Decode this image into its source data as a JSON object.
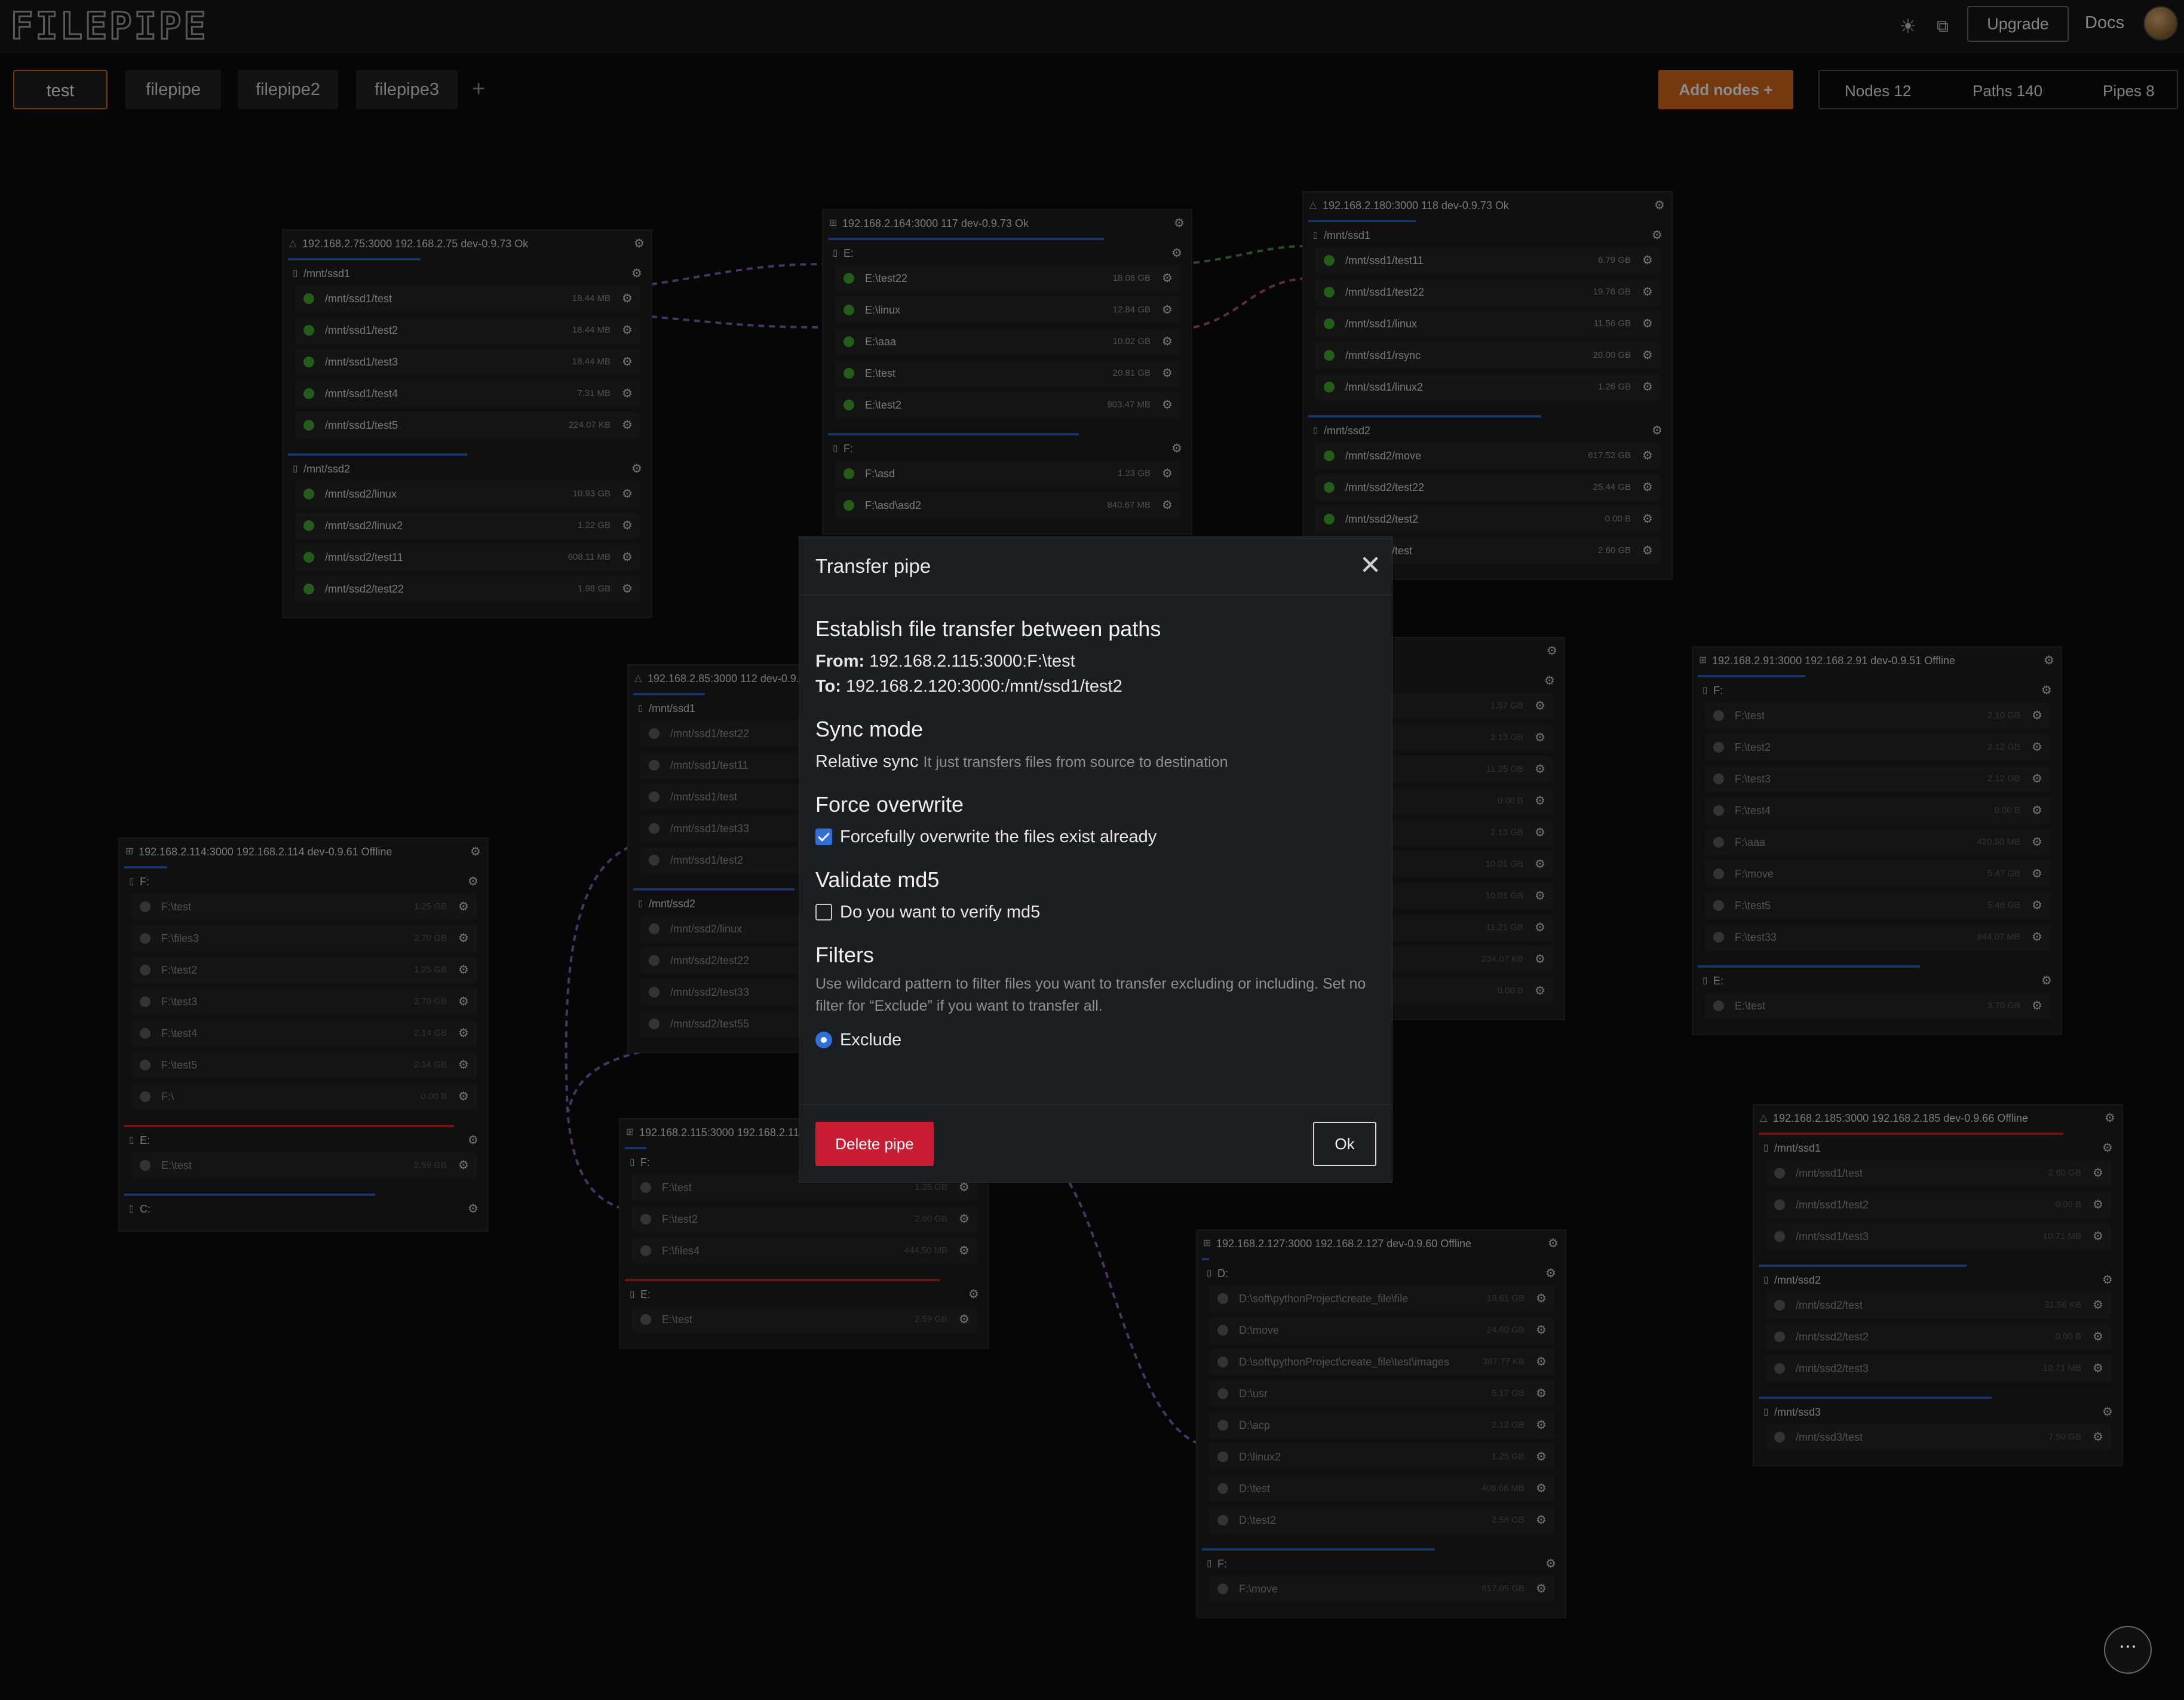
{
  "app": {
    "logo": "FILEPIPE"
  },
  "header": {
    "upgrade_label": "Upgrade",
    "docs_label": "Docs"
  },
  "tabs": [
    {
      "label": "test",
      "active": true
    },
    {
      "label": "filepipe"
    },
    {
      "label": "filepipe2"
    },
    {
      "label": "filepipe3"
    }
  ],
  "toolbar": {
    "add_nodes_label": "Add nodes",
    "nodes_stat": "Nodes 12",
    "paths_stat": "Paths 140",
    "pipes_stat": "Pipes 8"
  },
  "colors": {
    "accent": "#c9631b",
    "link_purple": "#7e5bb0",
    "link_green": "#3f8f3a",
    "link_pink": "#a0506a",
    "ok_dot": "#3e9f2c",
    "primary_blue": "#2f6fdc",
    "danger": "#c81d33"
  },
  "nodes": [
    {
      "id": "n75",
      "os": "linux",
      "status": "ok",
      "header": "192.168.2.75:3000  192.168.2.75  dev-0.9.73  Ok",
      "drives": [
        {
          "name": "/mnt/ssd1",
          "usage": 0.37,
          "bar_color": "blue",
          "paths": [
            {
              "name": "/mnt/ssd1/test",
              "size": "18.44 MB"
            },
            {
              "name": "/mnt/ssd1/test2",
              "size": "18.44 MB"
            },
            {
              "name": "/mnt/ssd1/test3",
              "size": "18.44 MB"
            },
            {
              "name": "/mnt/ssd1/test4",
              "size": "7.31 MB"
            },
            {
              "name": "/mnt/ssd1/test5",
              "size": "224.07 KB"
            }
          ]
        },
        {
          "name": "/mnt/ssd2",
          "usage": 0.5,
          "bar_color": "blue",
          "paths": [
            {
              "name": "/mnt/ssd2/linux",
              "size": "10.93 GB"
            },
            {
              "name": "/mnt/ssd2/linux2",
              "size": "1.22 GB"
            },
            {
              "name": "/mnt/ssd2/test11",
              "size": "608.11 MB"
            },
            {
              "name": "/mnt/ssd2/test22",
              "size": "1.98 GB"
            }
          ]
        }
      ]
    },
    {
      "id": "n164",
      "os": "windows",
      "status": "ok",
      "header": "192.168.2.164:3000  117  dev-0.9.73  Ok",
      "drives": [
        {
          "name": "E:",
          "usage": 0.77,
          "bar_color": "blue",
          "paths": [
            {
              "name": "E:\\test22",
              "size": "18.08 GB"
            },
            {
              "name": "E:\\linux",
              "size": "12.84 GB"
            },
            {
              "name": "E:\\aaa",
              "size": "10.02 GB"
            },
            {
              "name": "E:\\test",
              "size": "20.81 GB"
            },
            {
              "name": "E:\\test2",
              "size": "903.47 MB"
            }
          ]
        },
        {
          "name": "F:",
          "usage": 0.7,
          "bar_color": "blue",
          "paths": [
            {
              "name": "F:\\asd",
              "size": "1.23 GB"
            },
            {
              "name": "F:\\asd\\asd2",
              "size": "840.67 MB"
            }
          ]
        }
      ]
    },
    {
      "id": "n180",
      "os": "linux",
      "status": "ok",
      "header": "192.168.2.180:3000  118  dev-0.9.73  Ok",
      "drives": [
        {
          "name": "/mnt/ssd1",
          "usage": 0.3,
          "bar_color": "blue",
          "paths": [
            {
              "name": "/mnt/ssd1/test11",
              "size": "6.79 GB"
            },
            {
              "name": "/mnt/ssd1/test22",
              "size": "19.76 GB"
            },
            {
              "name": "/mnt/ssd1/linux",
              "size": "11.56 GB"
            },
            {
              "name": "/mnt/ssd1/rsync",
              "size": "20.00 GB"
            },
            {
              "name": "/mnt/ssd1/linux2",
              "size": "1.26 GB"
            }
          ]
        },
        {
          "name": "/mnt/ssd2",
          "usage": 0.65,
          "bar_color": "blue",
          "paths": [
            {
              "name": "/mnt/ssd2/move",
              "size": "617.52 GB"
            },
            {
              "name": "/mnt/ssd2/test22",
              "size": "25.44 GB"
            },
            {
              "name": "/mnt/ssd2/test2",
              "size": "0.00 B"
            },
            {
              "name": "/mnt/ssd2/test",
              "size": "2.60 GB"
            }
          ]
        }
      ]
    },
    {
      "id": "n85",
      "os": "linux",
      "status": "offline",
      "header": "192.168.2.85:3000  112  dev-0.9.73  Offline",
      "drives": [
        {
          "name": "/mnt/ssd1",
          "usage": 0.2,
          "bar_color": "blue",
          "paths": [
            {
              "name": "/mnt/ssd1/test22",
              "size": ""
            },
            {
              "name": "/mnt/ssd1/test11",
              "size": ""
            },
            {
              "name": "/mnt/ssd1/test",
              "size": ""
            },
            {
              "name": "/mnt/ssd1/test33",
              "size": ""
            },
            {
              "name": "/mnt/ssd1/test2",
              "size": ""
            }
          ]
        },
        {
          "name": "/mnt/ssd2",
          "usage": 0.45,
          "bar_color": "blue",
          "paths": [
            {
              "name": "/mnt/ssd2/linux",
              "size": ""
            },
            {
              "name": "/mnt/ssd2/test22",
              "size": ""
            },
            {
              "name": "/mnt/ssd2/test33",
              "size": ""
            },
            {
              "name": "/mnt/ssd2/test55",
              "size": ""
            }
          ]
        }
      ]
    },
    {
      "id": "n114",
      "os": "windows",
      "status": "offline",
      "header": "192.168.2.114:3000  192.168.2.114  dev-0.9.61  Offline",
      "drives": [
        {
          "name": "F:",
          "usage": 0.12,
          "bar_color": "blue",
          "paths": [
            {
              "name": "F:\\test",
              "size": "1.25 GB"
            },
            {
              "name": "F:\\files3",
              "size": "2.70 GB"
            },
            {
              "name": "F:\\test2",
              "size": "1.25 GB"
            },
            {
              "name": "F:\\test3",
              "size": "2.70 GB"
            },
            {
              "name": "F:\\test4",
              "size": "2.14 GB"
            },
            {
              "name": "F:\\test5",
              "size": "2.14 GB"
            },
            {
              "name": "F:\\",
              "size": "0.00 B"
            }
          ]
        },
        {
          "name": "E:",
          "usage": 0.92,
          "bar_color": "red",
          "paths": [
            {
              "name": "E:\\test",
              "size": "2.59 GB"
            }
          ]
        },
        {
          "name": "C:",
          "usage": 0.7,
          "bar_color": "blue",
          "paths": []
        }
      ]
    },
    {
      "id": "n115",
      "os": "windows",
      "status": "offline",
      "header": "192.168.2.115:3000  192.168.2.115  dev-0.9.61  Offline",
      "drives": [
        {
          "name": "F:",
          "usage": 0.06,
          "bar_color": "blue",
          "paths": [
            {
              "name": "F:\\test",
              "size": "1.25 GB"
            },
            {
              "name": "F:\\test2",
              "size": "2.60 GB"
            },
            {
              "name": "F:\\files4",
              "size": "444.50 MB"
            }
          ]
        },
        {
          "name": "E:",
          "usage": 0.88,
          "bar_color": "red",
          "paths": [
            {
              "name": "E:\\test",
              "size": "2.59 GB"
            }
          ]
        }
      ]
    },
    {
      "id": "nmid",
      "os": "windows",
      "status": "offline",
      "header": "Offline",
      "drives": [
        {
          "name": "",
          "usage": 0,
          "bar_color": "blue",
          "paths": [
            {
              "name": "",
              "size": "1.57 GB"
            },
            {
              "name": "",
              "size": "2.13 GB"
            },
            {
              "name": "",
              "size": "11.25 GB"
            },
            {
              "name": "",
              "size": "0.00 B"
            },
            {
              "name": "",
              "size": "2.13 GB"
            },
            {
              "name": "",
              "size": "10.01 GB"
            },
            {
              "name": "",
              "size": "10.01 GB"
            },
            {
              "name": "",
              "size": "11.21 GB"
            },
            {
              "name": "",
              "size": "234.07 KB"
            },
            {
              "name": "",
              "size": "0.00 B"
            }
          ]
        }
      ]
    },
    {
      "id": "n91",
      "os": "windows",
      "status": "offline",
      "header": "192.168.2.91:3000  192.168.2.91  dev-0.9.51  Offline",
      "drives": [
        {
          "name": "F:",
          "usage": 0.3,
          "bar_color": "blue",
          "paths": [
            {
              "name": "F:\\test",
              "size": "2.10 GB"
            },
            {
              "name": "F:\\test2",
              "size": "2.12 GB"
            },
            {
              "name": "F:\\test3",
              "size": "2.12 GB"
            },
            {
              "name": "F:\\test4",
              "size": "0.00 B"
            },
            {
              "name": "F:\\aaa",
              "size": "420.50 MB"
            },
            {
              "name": "F:\\move",
              "size": "5.47 GB"
            },
            {
              "name": "F:\\test5",
              "size": "5.46 GB"
            },
            {
              "name": "F:\\test33",
              "size": "844.07 MB"
            }
          ]
        },
        {
          "name": "E:",
          "usage": 0.62,
          "bar_color": "blue",
          "paths": [
            {
              "name": "E:\\test",
              "size": "3.70 GB"
            }
          ]
        }
      ]
    },
    {
      "id": "n185",
      "os": "linux",
      "status": "offline",
      "header": "192.168.2.185:3000  192.168.2.185  dev-0.9.66  Offline",
      "drives": [
        {
          "name": "/mnt/ssd1",
          "usage": 0.85,
          "bar_color": "red",
          "paths": [
            {
              "name": "/mnt/ssd1/test",
              "size": "2.60 GB"
            },
            {
              "name": "/mnt/ssd1/test2",
              "size": "0.00 B"
            },
            {
              "name": "/mnt/ssd1/test3",
              "size": "10.71 MB"
            }
          ]
        },
        {
          "name": "/mnt/ssd2",
          "usage": 0.58,
          "bar_color": "blue",
          "paths": [
            {
              "name": "/mnt/ssd2/test",
              "size": "31.56 KB"
            },
            {
              "name": "/mnt/ssd2/test2",
              "size": "0.00 B"
            },
            {
              "name": "/mnt/ssd2/test3",
              "size": "10.71 MB"
            }
          ]
        },
        {
          "name": "/mnt/ssd3",
          "usage": 0.65,
          "bar_color": "blue",
          "paths": [
            {
              "name": "/mnt/ssd3/test",
              "size": "7.50 GB"
            }
          ]
        }
      ]
    },
    {
      "id": "n127",
      "os": "windows",
      "status": "offline",
      "header": "192.168.2.127:3000  192.168.2.127  dev-0.9.60  Offline",
      "drives": [
        {
          "name": "D:",
          "usage": 0.02,
          "bar_color": "blue",
          "paths": [
            {
              "name": "D:\\soft\\pythonProject\\create_file\\file",
              "size": "18.61 GB"
            },
            {
              "name": "D:\\move",
              "size": "24.60 GB"
            },
            {
              "name": "D:\\soft\\pythonProject\\create_file\\test\\images",
              "size": "367.77 KB"
            },
            {
              "name": "D:\\usr",
              "size": "5.17 GB"
            },
            {
              "name": "D:\\acp",
              "size": "2.12 GB"
            },
            {
              "name": "D:\\linux2",
              "size": "1.25 GB"
            },
            {
              "name": "D:\\test",
              "size": "408.66 MB"
            },
            {
              "name": "D:\\test2",
              "size": "2.56 GB"
            }
          ]
        },
        {
          "name": "F:",
          "usage": 0.65,
          "bar_color": "blue",
          "paths": [
            {
              "name": "F:\\move",
              "size": "617.05 GB"
            }
          ]
        }
      ]
    }
  ],
  "modal": {
    "title": "Transfer pipe",
    "heading": "Establish file transfer between paths",
    "from_label": "From:",
    "from_value": "192.168.2.115:3000:F:\\test",
    "to_label": "To:",
    "to_value": "192.168.2.120:3000:/mnt/ssd1/test2",
    "sync_title": "Sync mode",
    "sync_value": "Relative sync",
    "sync_desc": "It just transfers files from source to destination",
    "overwrite_title": "Force overwrite",
    "overwrite_label": "Forcefully overwrite the files exist already",
    "overwrite_checked": true,
    "md5_title": "Validate md5",
    "md5_label": "Do you want to verify md5",
    "md5_checked": false,
    "filters_title": "Filters",
    "filters_desc": "Use wildcard pattern to filter files you want to transfer excluding or including. Set no filter for “Exclude” if you want to transfer all.",
    "filter_mode": "Exclude",
    "delete_label": "Delete pipe",
    "ok_label": "Ok"
  },
  "fab": {
    "label": "⋯"
  }
}
